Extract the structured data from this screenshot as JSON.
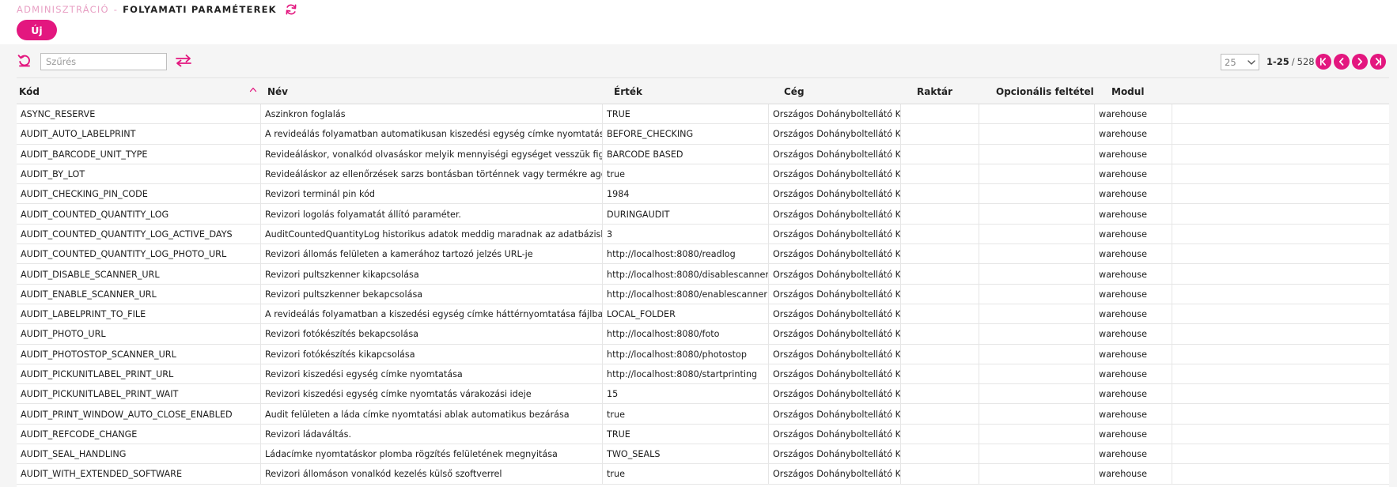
{
  "header": {
    "breadcrumb_parent": "ADMINISZTRÁCIÓ",
    "breadcrumb_sep": "-",
    "breadcrumb_current": "FOLYAMATI PARAMÉTEREK",
    "new_button_label": "Új"
  },
  "toolbar": {
    "filter_placeholder": "Szűrés",
    "page_size": "25",
    "page_range": "1-25",
    "page_sep": "/",
    "page_total": "528"
  },
  "colors": {
    "accent": "#e3177f",
    "breadcrumb_parent": "#e8a0c4"
  },
  "icons": {
    "title_refresh": "refresh-icon",
    "reset": "reset-icon",
    "swap": "swap-arrows-icon",
    "first": "first-page-icon",
    "prev": "prev-page-icon",
    "next": "next-page-icon",
    "last": "last-page-icon"
  },
  "table": {
    "columns": {
      "kod": "Kód",
      "nev": "Név",
      "ertek": "Érték",
      "ceg": "Cég",
      "raktar": "Raktár",
      "opcionalis": "Opcionális feltétel",
      "modul": "Modul"
    },
    "rows": [
      {
        "kod": "ASYNC_RESERVE",
        "nev": "Aszinkron foglalás",
        "ertek": "TRUE",
        "ceg": "Országos Dohányboltellátó Kft",
        "raktar": "",
        "opcionalis": "",
        "modul": "warehouse"
      },
      {
        "kod": "AUDIT_AUTO_LABELPRINT",
        "nev": "A revideálás folyamatban automatikusan kiszedési egység címke nyomtatása",
        "ertek": "BEFORE_CHECKING",
        "ceg": "Országos Dohányboltellátó Kft",
        "raktar": "",
        "opcionalis": "",
        "modul": "warehouse"
      },
      {
        "kod": "AUDIT_BARCODE_UNIT_TYPE",
        "nev": "Revideáláskor, vonalkód olvasáskor melyik mennyiségi egységet vesszük figyelembe",
        "ertek": "BARCODE BASED",
        "ceg": "Országos Dohányboltellátó Kft",
        "raktar": "",
        "opcionalis": "",
        "modul": "warehouse"
      },
      {
        "kod": "AUDIT_BY_LOT",
        "nev": "Revideáláskor az ellenőrzések sarzs bontásban történnek vagy termékre aggregálva",
        "ertek": "true",
        "ceg": "Országos Dohányboltellátó Kft",
        "raktar": "",
        "opcionalis": "",
        "modul": "warehouse"
      },
      {
        "kod": "AUDIT_CHECKING_PIN_CODE",
        "nev": "Revizori terminál pin kód",
        "ertek": "1984",
        "ceg": "Országos Dohányboltellátó Kft",
        "raktar": "",
        "opcionalis": "",
        "modul": "warehouse"
      },
      {
        "kod": "AUDIT_COUNTED_QUANTITY_LOG",
        "nev": "Revizori logolás folyamatát állító paraméter.",
        "ertek": "DURINGAUDIT",
        "ceg": "Országos Dohányboltellátó Kft",
        "raktar": "",
        "opcionalis": "",
        "modul": "warehouse"
      },
      {
        "kod": "AUDIT_COUNTED_QUANTITY_LOG_ACTIVE_DAYS",
        "nev": "AuditCountedQuantityLog historikus adatok meddig maradnak az adatbázisban.",
        "ertek": "3",
        "ceg": "Országos Dohányboltellátó Kft",
        "raktar": "",
        "opcionalis": "",
        "modul": "warehouse"
      },
      {
        "kod": "AUDIT_COUNTED_QUANTITY_LOG_PHOTO_URL",
        "nev": "Revizori állomás felületen a kamerához tartozó jelzés URL-je",
        "ertek": "http://localhost:8080/readlog",
        "ceg": "Országos Dohányboltellátó Kft",
        "raktar": "",
        "opcionalis": "",
        "modul": "warehouse"
      },
      {
        "kod": "AUDIT_DISABLE_SCANNER_URL",
        "nev": "Revizori pultszkenner kikapcsolása",
        "ertek": "http://localhost:8080/disablescanner",
        "ceg": "Országos Dohányboltellátó Kft",
        "raktar": "",
        "opcionalis": "",
        "modul": "warehouse"
      },
      {
        "kod": "AUDIT_ENABLE_SCANNER_URL",
        "nev": "Revizori pultszkenner bekapcsolása",
        "ertek": "http://localhost:8080/enablescanner",
        "ceg": "Országos Dohányboltellátó Kft",
        "raktar": "",
        "opcionalis": "",
        "modul": "warehouse"
      },
      {
        "kod": "AUDIT_LABELPRINT_TO_FILE",
        "nev": "A revideálás folyamatban a kiszedési egység címke háttérnyomtatása fájlba",
        "ertek": "LOCAL_FOLDER",
        "ceg": "Országos Dohányboltellátó Kft",
        "raktar": "",
        "opcionalis": "",
        "modul": "warehouse"
      },
      {
        "kod": "AUDIT_PHOTO_URL",
        "nev": "Revizori fotókészítés bekapcsolása",
        "ertek": "http://localhost:8080/foto",
        "ceg": "Országos Dohányboltellátó Kft",
        "raktar": "",
        "opcionalis": "",
        "modul": "warehouse"
      },
      {
        "kod": "AUDIT_PHOTOSTOP_SCANNER_URL",
        "nev": "Revizori fotókészítés kikapcsolása",
        "ertek": "http://localhost:8080/photostop",
        "ceg": "Országos Dohányboltellátó Kft",
        "raktar": "",
        "opcionalis": "",
        "modul": "warehouse"
      },
      {
        "kod": "AUDIT_PICKUNITLABEL_PRINT_URL",
        "nev": "Revizori kiszedési egység címke nyomtatása",
        "ertek": "http://localhost:8080/startprinting",
        "ceg": "Országos Dohányboltellátó Kft",
        "raktar": "",
        "opcionalis": "",
        "modul": "warehouse"
      },
      {
        "kod": "AUDIT_PICKUNITLABEL_PRINT_WAIT",
        "nev": "Revizori kiszedési egység címke nyomtatás várakozási ideje",
        "ertek": "15",
        "ceg": "Országos Dohányboltellátó Kft",
        "raktar": "",
        "opcionalis": "",
        "modul": "warehouse"
      },
      {
        "kod": "AUDIT_PRINT_WINDOW_AUTO_CLOSE_ENABLED",
        "nev": "Audit felületen a láda címke nyomtatási ablak automatikus bezárása",
        "ertek": "true",
        "ceg": "Országos Dohányboltellátó Kft",
        "raktar": "",
        "opcionalis": "",
        "modul": "warehouse"
      },
      {
        "kod": "AUDIT_REFCODE_CHANGE",
        "nev": "Revizori ládaváltás.",
        "ertek": "TRUE",
        "ceg": "Országos Dohányboltellátó Kft",
        "raktar": "",
        "opcionalis": "",
        "modul": "warehouse"
      },
      {
        "kod": "AUDIT_SEAL_HANDLING",
        "nev": "Ládacímke nyomtatáskor plomba rögzítés felületének megnyitása",
        "ertek": "TWO_SEALS",
        "ceg": "Országos Dohányboltellátó Kft",
        "raktar": "",
        "opcionalis": "",
        "modul": "warehouse"
      },
      {
        "kod": "AUDIT_WITH_EXTENDED_SOFTWARE",
        "nev": "Revizori állomáson vonalkód kezelés külső szoftverrel",
        "ertek": "true",
        "ceg": "Országos Dohányboltellátó Kft",
        "raktar": "",
        "opcionalis": "",
        "modul": "warehouse"
      }
    ]
  }
}
